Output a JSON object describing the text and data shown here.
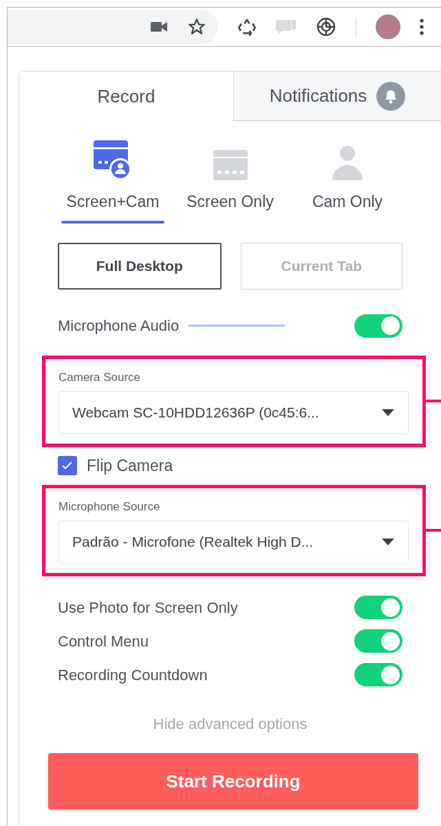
{
  "tabs": [
    {
      "label": "Record",
      "selected": true
    },
    {
      "label": "Notifications",
      "selected": false
    }
  ],
  "modes": [
    {
      "kind": "screen_cam",
      "label": "Screen+Cam",
      "selected": true
    },
    {
      "kind": "screen",
      "label": "Screen Only",
      "selected": false
    },
    {
      "kind": "cam",
      "label": "Cam Only",
      "selected": false
    }
  ],
  "capture_area": [
    {
      "label": "Full Desktop",
      "selected": true
    },
    {
      "label": "Current Tab",
      "selected": false
    }
  ],
  "microphone_audio": {
    "label": "Microphone Audio",
    "on": true
  },
  "camera_source": {
    "label": "Camera Source",
    "value": "Webcam SC-10HDD12636P (0c45:6...",
    "highlighted": true
  },
  "flip_camera": {
    "label": "Flip Camera",
    "checked": true
  },
  "microphone_source": {
    "label": "Microphone Source",
    "value": "Padrão - Microfone (Realtek High D...",
    "highlighted": true
  },
  "toggles": [
    {
      "label": "Use Photo for Screen Only",
      "on": true
    },
    {
      "label": "Control Menu",
      "on": true
    },
    {
      "label": "Recording Countdown",
      "on": true
    }
  ],
  "advanced_link": "Hide advanced options",
  "start_button": "Start Recording"
}
